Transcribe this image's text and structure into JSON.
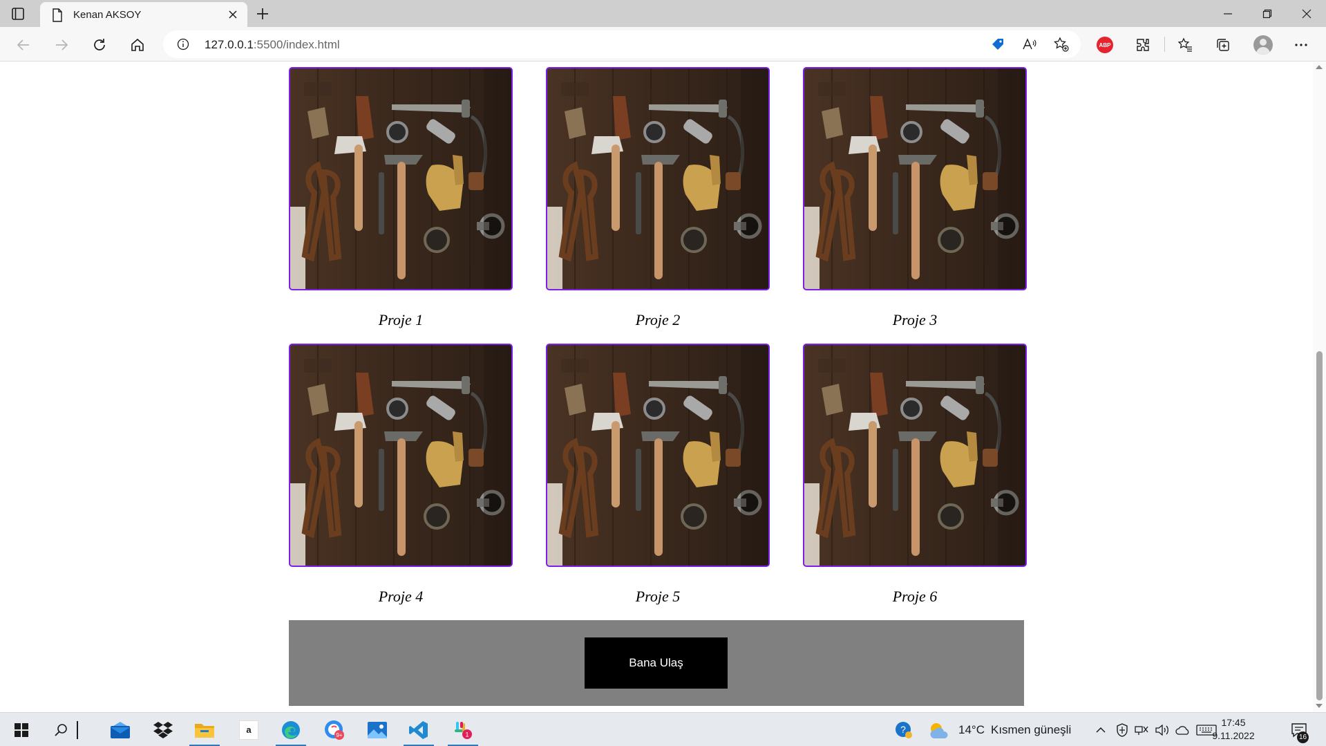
{
  "browser": {
    "tab_title": "Kenan AKSOY",
    "url_host": "127.0.0.1",
    "url_path": ":5500/index.html",
    "extension_abp": "ABP"
  },
  "projects": [
    {
      "caption": "Proje 1"
    },
    {
      "caption": "Proje 2"
    },
    {
      "caption": "Proje 3"
    },
    {
      "caption": "Proje 4"
    },
    {
      "caption": "Proje 5"
    },
    {
      "caption": "Proje 6"
    }
  ],
  "contact": {
    "button_label": "Bana Ulaş"
  },
  "taskbar": {
    "amazon_label": "a",
    "weather_temp": "14°C",
    "weather_text": "Kısmen güneşli",
    "time": "17:45",
    "date": "9.11.2022",
    "notification_count": "16",
    "chat_badge": "9+",
    "slack_badge": "1"
  },
  "colors": {
    "image_border": "#7a1ee8",
    "contact_band": "#808080",
    "contact_button": "#000000"
  }
}
